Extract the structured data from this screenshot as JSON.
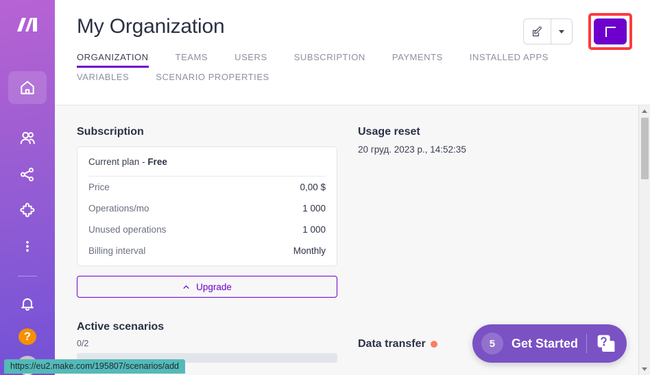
{
  "app": {
    "logo_name": "make-logo",
    "accent": "#6d00cc",
    "highlight_color": "#fb3b40",
    "sidebar_gradient_from": "#b763d4",
    "sidebar_gradient_to": "#7450d6"
  },
  "sidebar": {
    "items": [
      {
        "name": "home",
        "icon": "home-icon",
        "active": true
      },
      {
        "name": "teams",
        "icon": "users-icon",
        "active": false
      },
      {
        "name": "scenarios",
        "icon": "share-nodes-icon",
        "active": false
      },
      {
        "name": "apps",
        "icon": "puzzle-piece-icon",
        "active": false
      },
      {
        "name": "more",
        "icon": "more-vertical-icon",
        "active": false
      },
      {
        "name": "notifications",
        "icon": "bell-icon",
        "active": false
      },
      {
        "name": "help",
        "icon": "question-mark-icon",
        "active": false,
        "badge_color": "#f59000"
      },
      {
        "name": "profile",
        "icon": "avatar-icon",
        "active": false
      }
    ]
  },
  "header": {
    "title": "My Organization",
    "edit_button_icon": "edit-pencil-icon",
    "edit_dropdown_icon": "chevron-down-icon",
    "add_button_label": "+",
    "add_button_color": "#6d00cc",
    "tabs": [
      {
        "label": "ORGANIZATION",
        "active": true
      },
      {
        "label": "TEAMS",
        "active": false
      },
      {
        "label": "USERS",
        "active": false
      },
      {
        "label": "SUBSCRIPTION",
        "active": false
      },
      {
        "label": "PAYMENTS",
        "active": false
      },
      {
        "label": "INSTALLED APPS",
        "active": false
      },
      {
        "label": "VARIABLES",
        "active": false
      },
      {
        "label": "SCENARIO PROPERTIES",
        "active": false
      }
    ]
  },
  "subscription": {
    "section_title": "Subscription",
    "current_plan_prefix": "Current plan -",
    "current_plan_value": "Free",
    "rows": [
      {
        "key": "Price",
        "value": "0,00 $"
      },
      {
        "key": "Operations/mo",
        "value": "1 000"
      },
      {
        "key": "Unused operations",
        "value": "1 000"
      },
      {
        "key": "Billing interval",
        "value": "Monthly"
      }
    ],
    "upgrade_label": "Upgrade",
    "upgrade_icon": "chevron-up-icon"
  },
  "active_scenarios": {
    "title": "Active scenarios",
    "counter": "0/2",
    "progress_percent": 0
  },
  "usage_reset": {
    "title": "Usage reset",
    "date": "20 груд. 2023 р., 14:52:35"
  },
  "data_transfer": {
    "title": "Data transfer",
    "dot_color": "#f97f62"
  },
  "get_started": {
    "count": "5",
    "label": "Get Started",
    "icon": "question-card-icon",
    "color": "#7a52c4"
  },
  "status_bar": {
    "url": "https://eu2.make.com/195807/scenarios/add"
  },
  "scrollbar": {
    "up_icon": "triangle-up-icon",
    "down_icon": "triangle-down-icon"
  }
}
